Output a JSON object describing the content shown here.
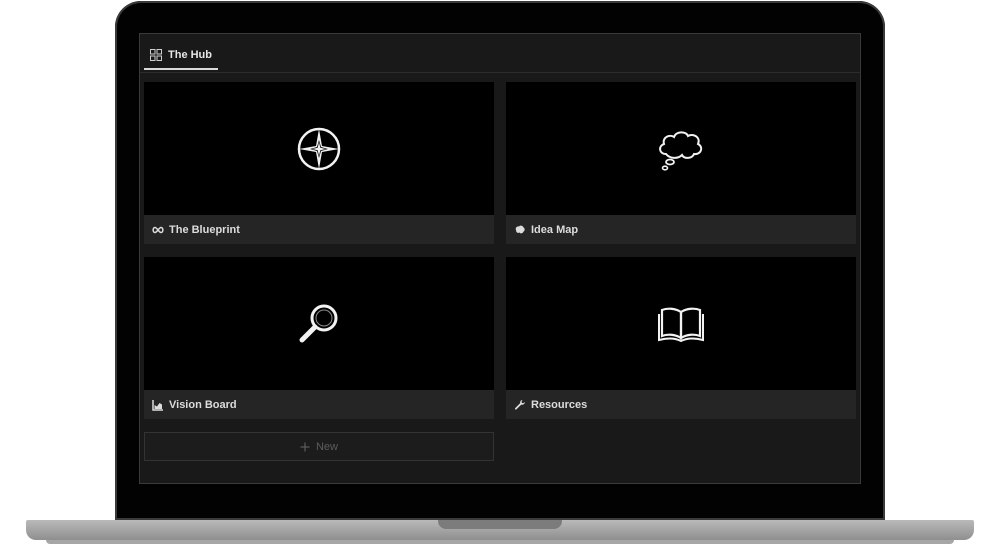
{
  "tab": {
    "label": "The Hub",
    "icon": "grid-icon"
  },
  "cards": [
    {
      "title": "The Blueprint",
      "small_icon": "infinity-icon",
      "cover_icon": "compass-star-icon"
    },
    {
      "title": "Idea Map",
      "small_icon": "brain-icon",
      "cover_icon": "thought-cloud-icon"
    },
    {
      "title": "Vision Board",
      "small_icon": "chart-icon",
      "cover_icon": "magnifier-icon"
    },
    {
      "title": "Resources",
      "small_icon": "wrench-icon",
      "cover_icon": "open-book-icon"
    }
  ],
  "new_button": {
    "label": "New",
    "icon": "plus-icon"
  },
  "colors": {
    "page_bg": "#191919",
    "card_bg": "#000000",
    "footer_bg": "#252525",
    "text": "#dcdcdc"
  }
}
